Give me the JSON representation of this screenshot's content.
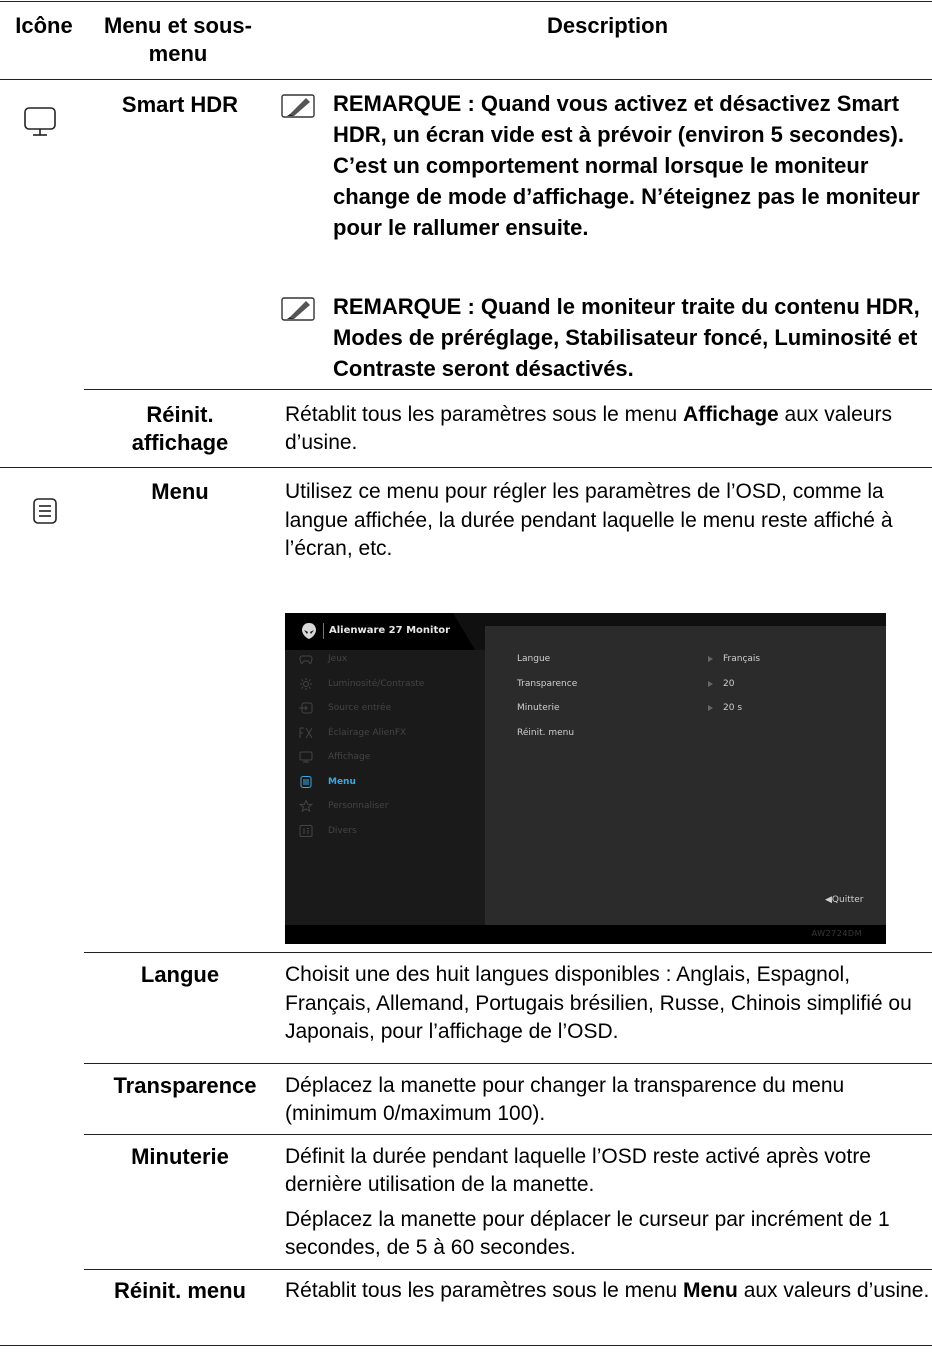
{
  "header": {
    "icon_col": "Icône",
    "menu_col": "Menu et sous-menu",
    "desc_col": "Description"
  },
  "rows": {
    "smart_hdr": {
      "label": "Smart HDR",
      "note1": "REMARQUE : Quand vous activez et désactivez Smart HDR, un écran vide est à prévoir (environ 5 secondes). C’est un comportement normal lorsque le moniteur change de mode d’affichage. N’éteignez pas le moniteur pour le rallumer ensuite.",
      "note2": "REMARQUE : Quand le moniteur traite du contenu HDR, Modes de préréglage, Stabilisateur foncé, Luminosité et Contraste seront désactivés."
    },
    "reinit_affichage": {
      "label": "Réinit. affichage",
      "desc_pre": "Rétablit tous les paramètres sous le menu ",
      "desc_bold": "Affichage",
      "desc_post": " aux valeurs d’usine."
    },
    "menu": {
      "label": "Menu",
      "desc": "Utilisez ce menu pour régler les paramètres de l’OSD, comme la langue affichée, la durée pendant laquelle le menu reste affiché à l’écran, etc."
    },
    "langue": {
      "label": "Langue",
      "desc": "Choisit une des huit langues disponibles : Anglais, Espagnol, Français, Allemand, Portugais brésilien, Russe, Chinois simplifié ou Japonais, pour l’affichage de l’OSD."
    },
    "transparence": {
      "label": "Transparence",
      "desc": "Déplacez la manette pour changer la transparence du menu (minimum 0/maximum 100)."
    },
    "minuterie": {
      "label": "Minuterie",
      "desc1": "Définit la durée pendant laquelle l’OSD reste activé après votre dernière utilisation de la manette.",
      "desc2": "Déplacez la manette pour déplacer le curseur par incrément de 1 secondes, de 5 à 60 secondes."
    },
    "reinit_menu": {
      "label": "Réinit. menu",
      "desc_pre": "Rétablit tous les paramètres sous le menu ",
      "desc_bold": "Menu",
      "desc_post": " aux valeurs d’usine."
    }
  },
  "osd": {
    "title": "Alienware 27 Monitor",
    "model": "AW2724DM",
    "quit": "◀Quitter",
    "menu_items": [
      {
        "label": "Jeux",
        "icon": "gamepad-icon"
      },
      {
        "label": "Luminosité/Contraste",
        "icon": "brightness-icon"
      },
      {
        "label": "Source entrée",
        "icon": "input-source-icon"
      },
      {
        "label": "Éclairage AlienFX",
        "icon": "fx-icon"
      },
      {
        "label": "Affichage",
        "icon": "display-icon"
      },
      {
        "label": "Menu",
        "icon": "menu-icon",
        "active": true
      },
      {
        "label": "Personnaliser",
        "icon": "star-icon"
      },
      {
        "label": "Divers",
        "icon": "info-icon"
      }
    ],
    "options": [
      {
        "label": "Langue",
        "value": "Français"
      },
      {
        "label": "Transparence",
        "value": "20"
      },
      {
        "label": "Minuterie",
        "value": "20 s"
      },
      {
        "label": "Réinit. menu",
        "value": ""
      }
    ],
    "active_color": "#3aa8e0"
  }
}
